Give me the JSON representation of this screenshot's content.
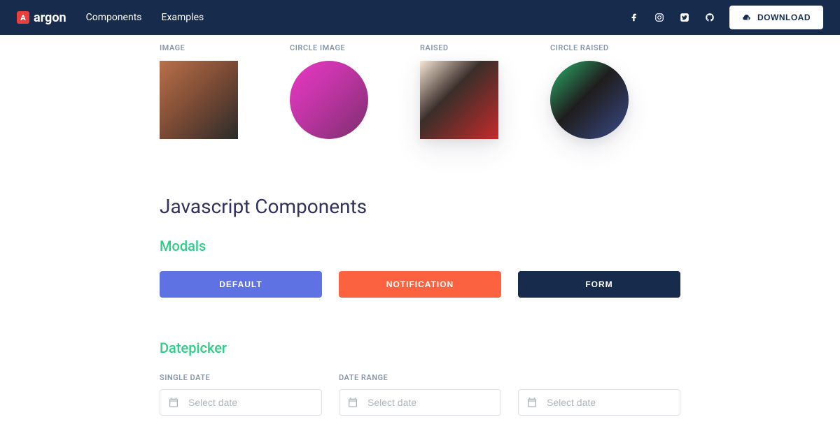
{
  "nav": {
    "brand": "argon",
    "links": [
      "Components",
      "Examples"
    ],
    "download_label": "DOWNLOAD"
  },
  "images": {
    "labels": [
      "IMAGE",
      "CIRCLE IMAGE",
      "RAISED",
      "CIRCLE RAISED"
    ]
  },
  "sections": {
    "js_components": "Javascript Components",
    "modals": "Modals",
    "datepicker": "Datepicker"
  },
  "modal_buttons": {
    "default": "DEFAULT",
    "notification": "NOTIFICATION",
    "form": "FORM"
  },
  "datepicker": {
    "single_label": "SINGLE DATE",
    "range_label": "DATE RANGE",
    "placeholder": "Select date"
  }
}
